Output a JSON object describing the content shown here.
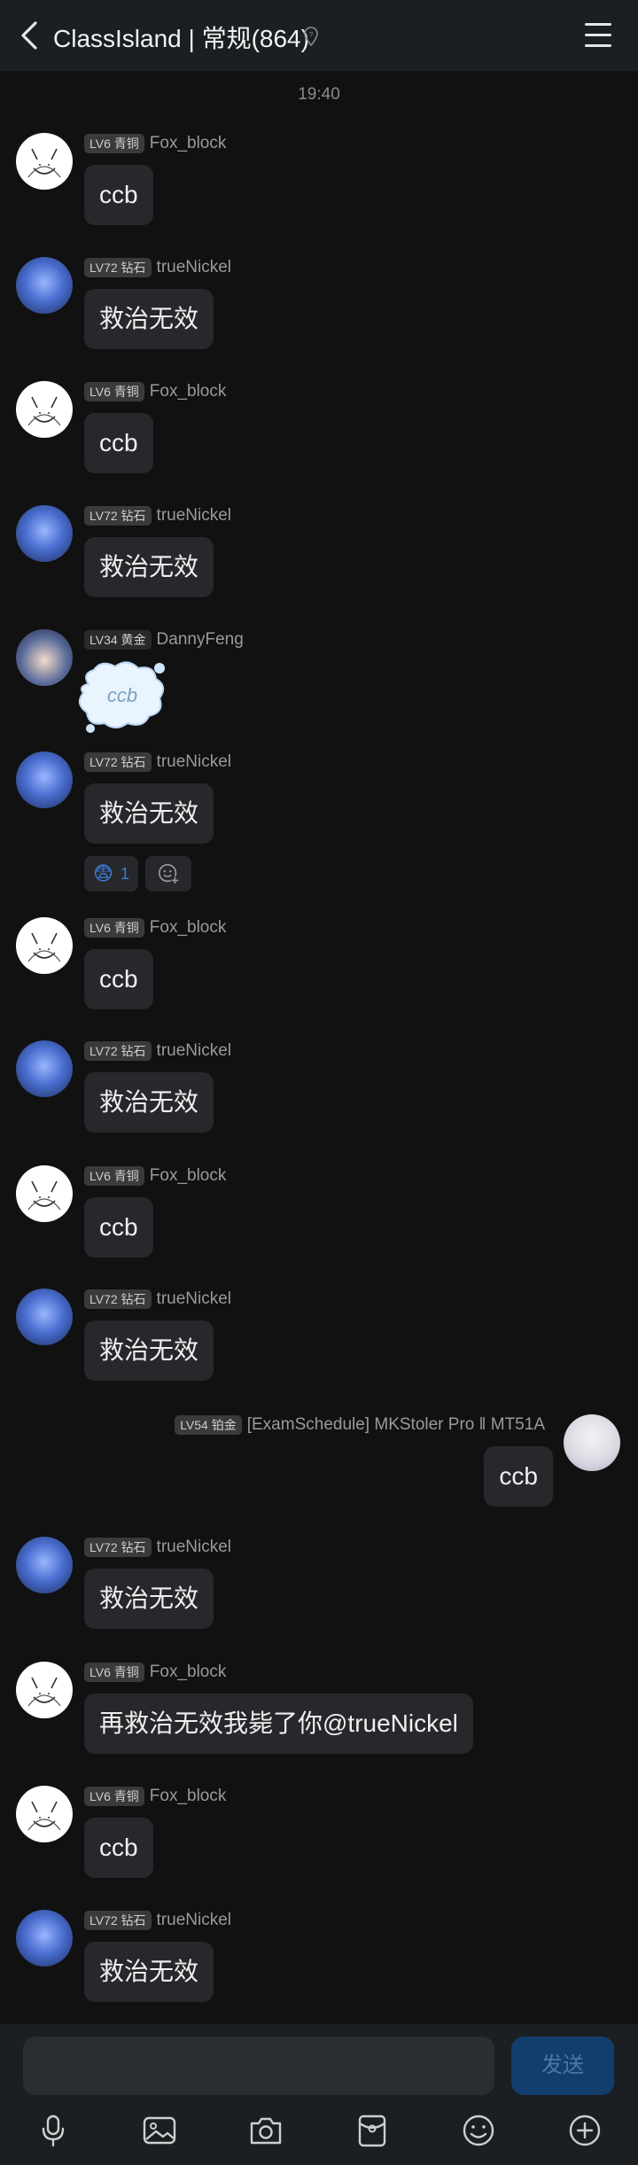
{
  "header": {
    "title": "ClassIsland | 常规(864)",
    "back_icon": "chevron-left-icon",
    "pin_icon": "location-pin-icon",
    "menu_icon": "hamburger-menu-icon"
  },
  "timestamp": "19:40",
  "messages": [
    {
      "sender": "Fox_block",
      "level": "LV6 青铜",
      "text": "ccb",
      "avatar": "fox-sketch"
    },
    {
      "sender": "trueNickel",
      "level": "LV72 钻石",
      "text": "救治无效",
      "avatar": "blue-anime"
    },
    {
      "sender": "Fox_block",
      "level": "LV6 青铜",
      "text": "ccb",
      "avatar": "fox-sketch"
    },
    {
      "sender": "trueNickel",
      "level": "LV72 钻石",
      "text": "救治无效",
      "avatar": "blue-anime"
    },
    {
      "sender": "DannyFeng",
      "level": "LV34 黄金",
      "sticker_text": "ccb",
      "avatar": "cat-ear-anime"
    },
    {
      "sender": "trueNickel",
      "level": "LV72 钻石",
      "text": "救治无效",
      "avatar": "blue-anime",
      "reactions": [
        {
          "emoji": "😨",
          "count": "1"
        }
      ]
    },
    {
      "sender": "Fox_block",
      "level": "LV6 青铜",
      "text": "ccb",
      "avatar": "fox-sketch"
    },
    {
      "sender": "trueNickel",
      "level": "LV72 钻石",
      "text": "救治无效",
      "avatar": "blue-anime"
    },
    {
      "sender": "Fox_block",
      "level": "LV6 青铜",
      "text": "ccb",
      "avatar": "fox-sketch"
    },
    {
      "sender": "trueNickel",
      "level": "LV72 钻石",
      "text": "救治无效",
      "avatar": "blue-anime"
    },
    {
      "sender": "[ExamSchedule] MKStoler Pro ‖ MT51A",
      "level": "LV54 铂金",
      "text": "ccb",
      "avatar": "white-hair-anime",
      "self": true
    },
    {
      "sender": "trueNickel",
      "level": "LV72 钻石",
      "text": "救治无效",
      "avatar": "blue-anime"
    },
    {
      "sender": "Fox_block",
      "level": "LV6 青铜",
      "text": "再救治无效我毙了你@trueNickel",
      "avatar": "fox-sketch"
    },
    {
      "sender": "Fox_block",
      "level": "LV6 青铜",
      "text": "ccb",
      "avatar": "fox-sketch"
    },
    {
      "sender": "trueNickel",
      "level": "LV72 钻石",
      "text": "救治无效",
      "avatar": "blue-anime"
    }
  ],
  "composer": {
    "send_label": "发送",
    "tools": [
      "microphone-icon",
      "image-icon",
      "camera-icon",
      "red-packet-icon",
      "emoji-icon",
      "plus-icon"
    ]
  },
  "colors": {
    "background": "#111111",
    "bubble": "#26282b",
    "header": "#1b1f22",
    "send_button": "#123e6e"
  }
}
